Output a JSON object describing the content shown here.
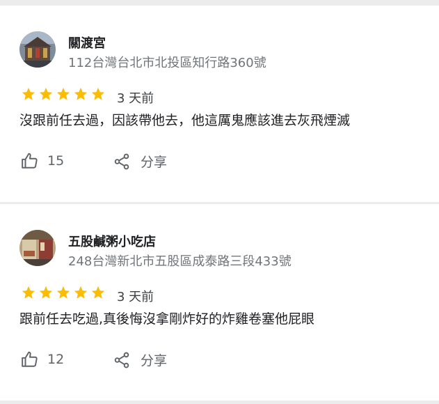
{
  "colors": {
    "star": "#fbbc04",
    "action_gray": "#5f6368",
    "address_gray": "#70757a",
    "divider": "#ececec"
  },
  "reviews": [
    {
      "place_name": "關渡宮",
      "address": "112台灣台北市北投區知行路360號",
      "rating": 5,
      "time": "3 天前",
      "text": "沒跟前任去過，因該帶他去，他這厲鬼應該進去灰飛煙滅",
      "likes": "15",
      "share_label": "分享",
      "avatar_icon": "temple-photo"
    },
    {
      "place_name": "五股鹹粥小吃店",
      "address": "248台灣新北市五股區成泰路三段433號",
      "rating": 5,
      "time": "3 天前",
      "text": "跟前任去吃過,真後悔沒拿剛炸好的炸雞卷塞他屁眼",
      "likes": "12",
      "share_label": "分享",
      "avatar_icon": "storefront-photo"
    }
  ]
}
